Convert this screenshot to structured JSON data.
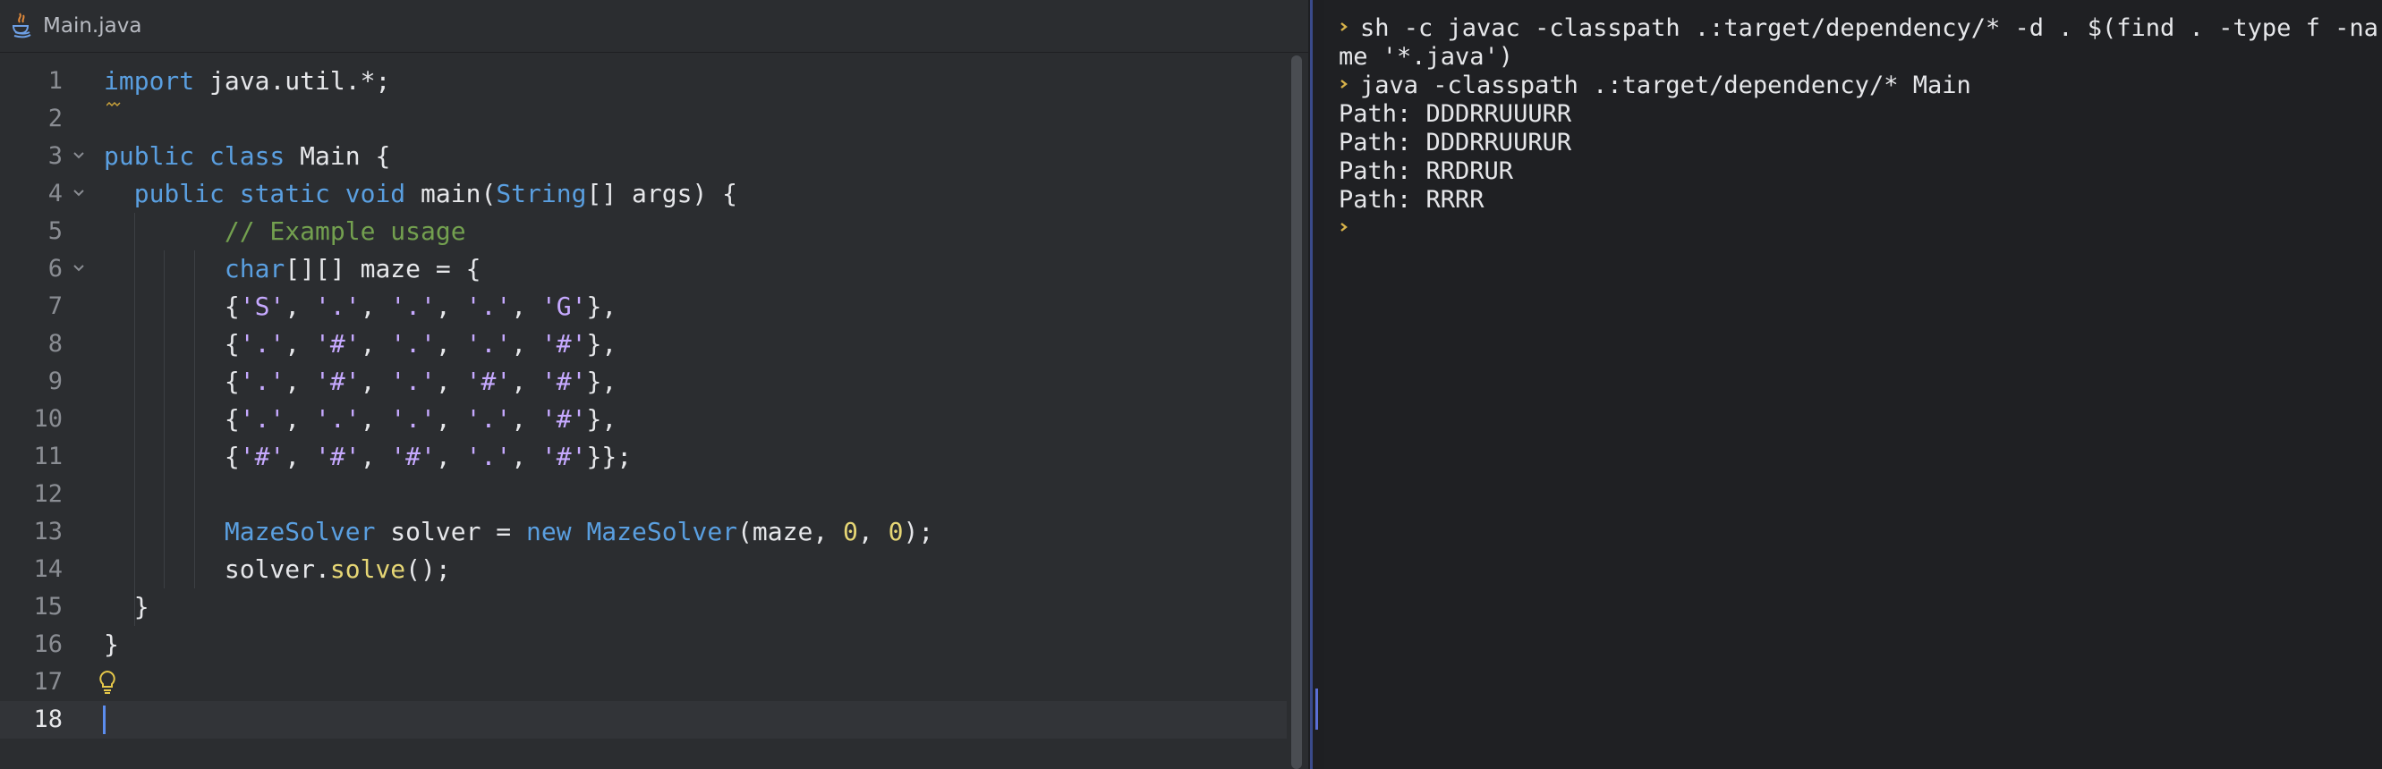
{
  "editor": {
    "tab": {
      "label": "Main.java",
      "icon": "java-file-icon"
    },
    "current_line": 18,
    "lines": [
      {
        "num": "1",
        "indent": "",
        "tokens": [
          {
            "t": "import",
            "c": "kw"
          },
          {
            "t": " java.util.*;",
            "c": "plain"
          }
        ]
      },
      {
        "num": "2",
        "indent": "",
        "tokens": []
      },
      {
        "num": "3",
        "indent": "",
        "tokens": [
          {
            "t": "public class",
            "c": "kw"
          },
          {
            "t": " Main {",
            "c": "plain"
          }
        ]
      },
      {
        "num": "4",
        "indent": "  ",
        "tokens": [
          {
            "t": "public static void",
            "c": "kw"
          },
          {
            "t": " main(",
            "c": "plain"
          },
          {
            "t": "String",
            "c": "cls"
          },
          {
            "t": "[] args) {",
            "c": "plain"
          }
        ]
      },
      {
        "num": "5",
        "indent": "        ",
        "tokens": [
          {
            "t": "// Example usage",
            "c": "cmt"
          }
        ]
      },
      {
        "num": "6",
        "indent": "        ",
        "tokens": [
          {
            "t": "char",
            "c": "kw"
          },
          {
            "t": "[][] maze = {",
            "c": "plain"
          }
        ]
      },
      {
        "num": "7",
        "indent": "        ",
        "tokens": [
          {
            "t": "{",
            "c": "plain"
          },
          {
            "t": "'S'",
            "c": "str"
          },
          {
            "t": ", ",
            "c": "plain"
          },
          {
            "t": "'.'",
            "c": "str"
          },
          {
            "t": ", ",
            "c": "plain"
          },
          {
            "t": "'.'",
            "c": "str"
          },
          {
            "t": ", ",
            "c": "plain"
          },
          {
            "t": "'.'",
            "c": "str"
          },
          {
            "t": ", ",
            "c": "plain"
          },
          {
            "t": "'G'",
            "c": "str"
          },
          {
            "t": "},",
            "c": "plain"
          }
        ]
      },
      {
        "num": "8",
        "indent": "        ",
        "tokens": [
          {
            "t": "{",
            "c": "plain"
          },
          {
            "t": "'.'",
            "c": "str"
          },
          {
            "t": ", ",
            "c": "plain"
          },
          {
            "t": "'#'",
            "c": "str"
          },
          {
            "t": ", ",
            "c": "plain"
          },
          {
            "t": "'.'",
            "c": "str"
          },
          {
            "t": ", ",
            "c": "plain"
          },
          {
            "t": "'.'",
            "c": "str"
          },
          {
            "t": ", ",
            "c": "plain"
          },
          {
            "t": "'#'",
            "c": "str"
          },
          {
            "t": "},",
            "c": "plain"
          }
        ]
      },
      {
        "num": "9",
        "indent": "        ",
        "tokens": [
          {
            "t": "{",
            "c": "plain"
          },
          {
            "t": "'.'",
            "c": "str"
          },
          {
            "t": ", ",
            "c": "plain"
          },
          {
            "t": "'#'",
            "c": "str"
          },
          {
            "t": ", ",
            "c": "plain"
          },
          {
            "t": "'.'",
            "c": "str"
          },
          {
            "t": ", ",
            "c": "plain"
          },
          {
            "t": "'#'",
            "c": "str"
          },
          {
            "t": ", ",
            "c": "plain"
          },
          {
            "t": "'#'",
            "c": "str"
          },
          {
            "t": "},",
            "c": "plain"
          }
        ]
      },
      {
        "num": "10",
        "indent": "        ",
        "tokens": [
          {
            "t": "{",
            "c": "plain"
          },
          {
            "t": "'.'",
            "c": "str"
          },
          {
            "t": ", ",
            "c": "plain"
          },
          {
            "t": "'.'",
            "c": "str"
          },
          {
            "t": ", ",
            "c": "plain"
          },
          {
            "t": "'.'",
            "c": "str"
          },
          {
            "t": ", ",
            "c": "plain"
          },
          {
            "t": "'.'",
            "c": "str"
          },
          {
            "t": ", ",
            "c": "plain"
          },
          {
            "t": "'#'",
            "c": "str"
          },
          {
            "t": "},",
            "c": "plain"
          }
        ]
      },
      {
        "num": "11",
        "indent": "        ",
        "tokens": [
          {
            "t": "{",
            "c": "plain"
          },
          {
            "t": "'#'",
            "c": "str"
          },
          {
            "t": ", ",
            "c": "plain"
          },
          {
            "t": "'#'",
            "c": "str"
          },
          {
            "t": ", ",
            "c": "plain"
          },
          {
            "t": "'#'",
            "c": "str"
          },
          {
            "t": ", ",
            "c": "plain"
          },
          {
            "t": "'.'",
            "c": "str"
          },
          {
            "t": ", ",
            "c": "plain"
          },
          {
            "t": "'#'",
            "c": "str"
          },
          {
            "t": "}};",
            "c": "plain"
          }
        ]
      },
      {
        "num": "12",
        "indent": "",
        "tokens": []
      },
      {
        "num": "13",
        "indent": "        ",
        "tokens": [
          {
            "t": "MazeSolver",
            "c": "cls"
          },
          {
            "t": " solver = ",
            "c": "plain"
          },
          {
            "t": "new",
            "c": "kw"
          },
          {
            "t": " ",
            "c": "plain"
          },
          {
            "t": "MazeSolver",
            "c": "cls"
          },
          {
            "t": "(maze, ",
            "c": "plain"
          },
          {
            "t": "0",
            "c": "num"
          },
          {
            "t": ", ",
            "c": "plain"
          },
          {
            "t": "0",
            "c": "num"
          },
          {
            "t": ");",
            "c": "plain"
          }
        ]
      },
      {
        "num": "14",
        "indent": "        ",
        "tokens": [
          {
            "t": "solver.",
            "c": "plain"
          },
          {
            "t": "solve",
            "c": "meth"
          },
          {
            "t": "();",
            "c": "plain"
          }
        ]
      },
      {
        "num": "15",
        "indent": "  ",
        "tokens": [
          {
            "t": "}",
            "c": "plain"
          }
        ]
      },
      {
        "num": "16",
        "indent": "",
        "tokens": [
          {
            "t": "}",
            "c": "plain"
          }
        ]
      },
      {
        "num": "17",
        "indent": "",
        "tokens": []
      },
      {
        "num": "18",
        "indent": "",
        "tokens": []
      }
    ],
    "fold_lines": [
      "3",
      "4",
      "6"
    ],
    "bulb_line": "17",
    "bulb_icon": "lightbulb-icon"
  },
  "terminal": {
    "prompt_icon": "prompt-chevron-icon",
    "lines": [
      {
        "prompt": true,
        "text": "sh -c javac -classpath .:target/dependency/* -d . $(find . -type f -na"
      },
      {
        "prompt": false,
        "text": "me '*.java')"
      },
      {
        "prompt": true,
        "text": "java -classpath .:target/dependency/* Main"
      },
      {
        "prompt": false,
        "text": "Path: DDDRRUUURR"
      },
      {
        "prompt": false,
        "text": "Path: DDDRRUURUR"
      },
      {
        "prompt": false,
        "text": "Path: RRDRUR"
      },
      {
        "prompt": false,
        "text": "Path: RRRR"
      },
      {
        "prompt": true,
        "text": ""
      }
    ]
  },
  "colors": {
    "keyword": "#5a9fe0",
    "comment": "#73a04f",
    "char_literal": "#c6a9ff",
    "number": "#e6d675",
    "prompt": "#d7b24a",
    "caret": "#5b8def"
  }
}
